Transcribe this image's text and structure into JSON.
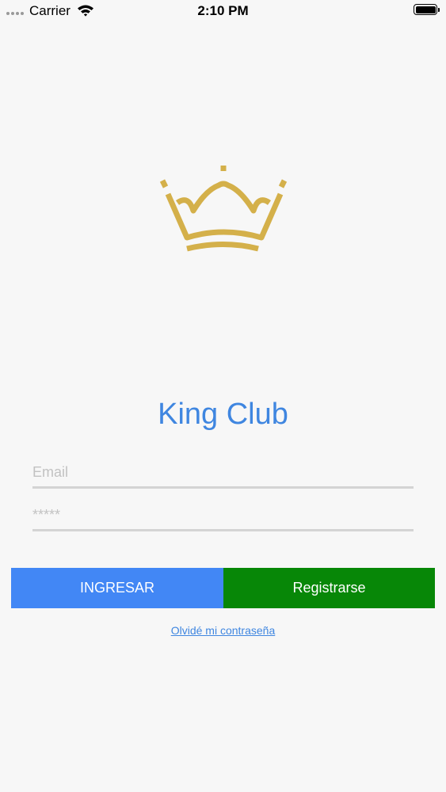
{
  "status_bar": {
    "carrier": "Carrier",
    "time": "2:10 PM"
  },
  "app": {
    "title": "King Club",
    "logo_icon": "crown-icon",
    "colors": {
      "title": "#3f86e0",
      "crown": "#d4b04a",
      "login_button": "#4287f5",
      "register_button": "#078707",
      "link": "#3f86e0"
    }
  },
  "form": {
    "email_placeholder": "Email",
    "password_placeholder": "*****"
  },
  "buttons": {
    "login_label": "INGRESAR",
    "register_label": "Registrarse"
  },
  "links": {
    "forgot_password": "Olvidé mi contraseña"
  }
}
